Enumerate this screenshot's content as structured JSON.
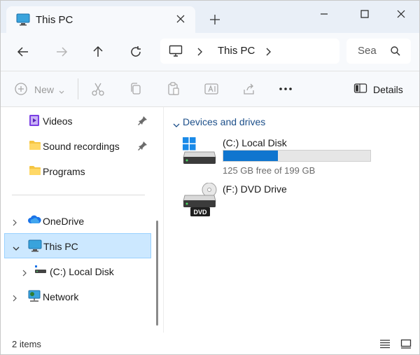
{
  "window": {
    "tab_title": "This PC"
  },
  "address": {
    "segment": "This PC"
  },
  "search": {
    "placeholder": "Sea"
  },
  "commandbar": {
    "new_label": "New",
    "details_label": "Details",
    "more_glyph": "•••"
  },
  "sidebar": {
    "quick_access": [
      {
        "label": "Videos",
        "icon": "videos-folder-icon",
        "pinned": true
      },
      {
        "label": "Sound recordings",
        "icon": "folder-icon",
        "pinned": true
      },
      {
        "label": "Programs",
        "icon": "folder-icon",
        "pinned": false
      }
    ],
    "tree": [
      {
        "label": "OneDrive",
        "icon": "cloud-icon",
        "expander": "collapsed"
      },
      {
        "label": "This PC",
        "icon": "this-pc-icon",
        "expander": "expanded",
        "selected": true
      },
      {
        "label": "(C:) Local Disk",
        "icon": "drive-icon",
        "expander": "collapsed"
      },
      {
        "label": "Network",
        "icon": "network-icon",
        "expander": "collapsed"
      }
    ]
  },
  "main": {
    "group_header": "Devices and drives",
    "drives": [
      {
        "name": "(C:) Local Disk",
        "free_text": "125 GB free of 199 GB",
        "used_fraction": 0.372,
        "icon": "windows-drive-icon"
      },
      {
        "name": "(F:) DVD Drive",
        "icon": "dvd-drive-icon",
        "badge": "DVD"
      }
    ]
  },
  "status": {
    "items_count": "2 items"
  },
  "colors": {
    "accent": "#0f75cf",
    "selection": "#cce8ff",
    "header_text": "#1c4f8a"
  }
}
